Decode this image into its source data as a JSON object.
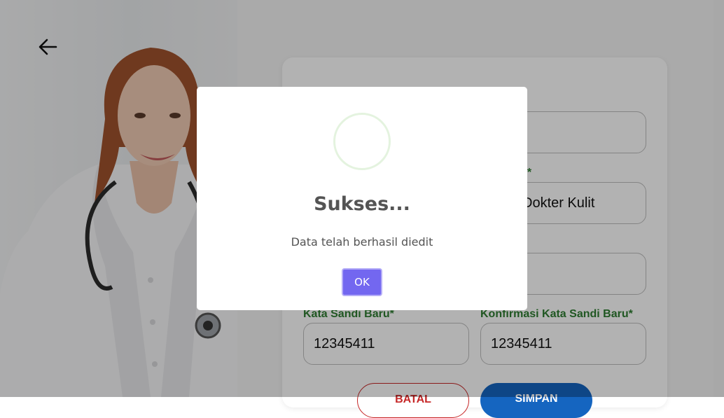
{
  "form": {
    "profession_value": "Dokter Kulit",
    "profession_label_fragment": "s*",
    "new_password_label": "Kata Sandi Baru*",
    "new_password_value": "12345411",
    "confirm_password_label": "Konfirmasi Kata Sandi Baru*",
    "confirm_password_value": "12345411",
    "reset_button_label": "BATAL",
    "save_button_label": "SIMPAN"
  },
  "dialog": {
    "icon": "success-circle-icon",
    "title": "Sukses...",
    "message": "Data telah berhasil diedit",
    "ok_label": "OK"
  },
  "colors": {
    "label_green": "#2e7d32",
    "save_blue": "#1565c0",
    "reset_red": "#c62828",
    "ok_purple": "#7367f0",
    "success_ring": "#e4f3df"
  }
}
